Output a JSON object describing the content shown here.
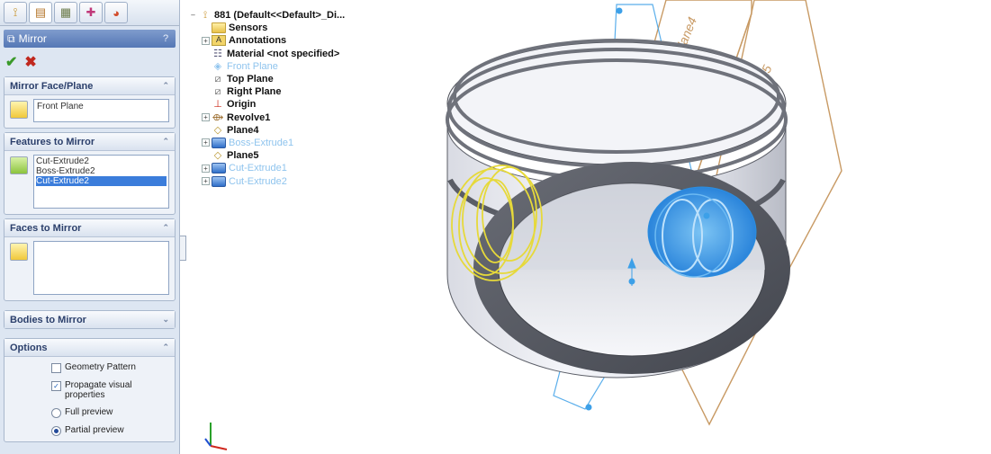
{
  "property_manager": {
    "tabs": [
      {
        "icon": "feature-manager-icon"
      },
      {
        "icon": "property-manager-icon"
      },
      {
        "icon": "configuration-manager-icon"
      },
      {
        "icon": "dimxpert-icon"
      },
      {
        "icon": "display-manager-icon"
      }
    ],
    "title": "Mirror",
    "help": "?",
    "ok_icon": "✔",
    "cancel_icon": "✖",
    "groups": {
      "mirror_face": {
        "header": "Mirror Face/Plane",
        "value": "Front Plane"
      },
      "features": {
        "header": "Features to Mirror",
        "items": [
          "Cut-Extrude2",
          "Boss-Extrude2",
          "Cut-Extrude2"
        ],
        "selected_index": 2
      },
      "faces": {
        "header": "Faces to Mirror"
      },
      "bodies": {
        "header": "Bodies to Mirror"
      },
      "options": {
        "header": "Options",
        "geometry_pattern": "Geometry Pattern",
        "propagate": "Propagate visual properties",
        "full_preview": "Full preview",
        "partial_preview": "Partial preview"
      }
    }
  },
  "feature_tree": {
    "root": "881 (Default<<Default>_Di...",
    "nodes": [
      {
        "label": "Sensors",
        "icon": "sensors-folder-icon",
        "faded": false
      },
      {
        "label": "Annotations",
        "icon": "annotations-icon",
        "faded": false
      },
      {
        "label": "Material <not specified>",
        "icon": "material-icon",
        "faded": false
      },
      {
        "label": "Front Plane",
        "icon": "plane-icon",
        "faded": true
      },
      {
        "label": "Top Plane",
        "icon": "plane-icon",
        "faded": false
      },
      {
        "label": "Right Plane",
        "icon": "plane-icon",
        "faded": false
      },
      {
        "label": "Origin",
        "icon": "origin-icon",
        "faded": false
      },
      {
        "label": "Revolve1",
        "icon": "revolve-icon",
        "faded": false
      },
      {
        "label": "Plane4",
        "icon": "plane-icon",
        "faded": false
      },
      {
        "label": "Boss-Extrude1",
        "icon": "extrude-icon",
        "faded": true
      },
      {
        "label": "Plane5",
        "icon": "plane-icon",
        "faded": false
      },
      {
        "label": "Cut-Extrude1",
        "icon": "extrude-icon",
        "faded": true
      },
      {
        "label": "Cut-Extrude2",
        "icon": "extrude-icon",
        "faded": true
      }
    ]
  },
  "viewport": {
    "plane_labels": [
      "Plane4",
      "Plane5"
    ],
    "colors": {
      "plane": "#c89a64",
      "preview": "#e6d93a",
      "selection": "#3da0e8",
      "part": "#e9ebf3"
    }
  }
}
